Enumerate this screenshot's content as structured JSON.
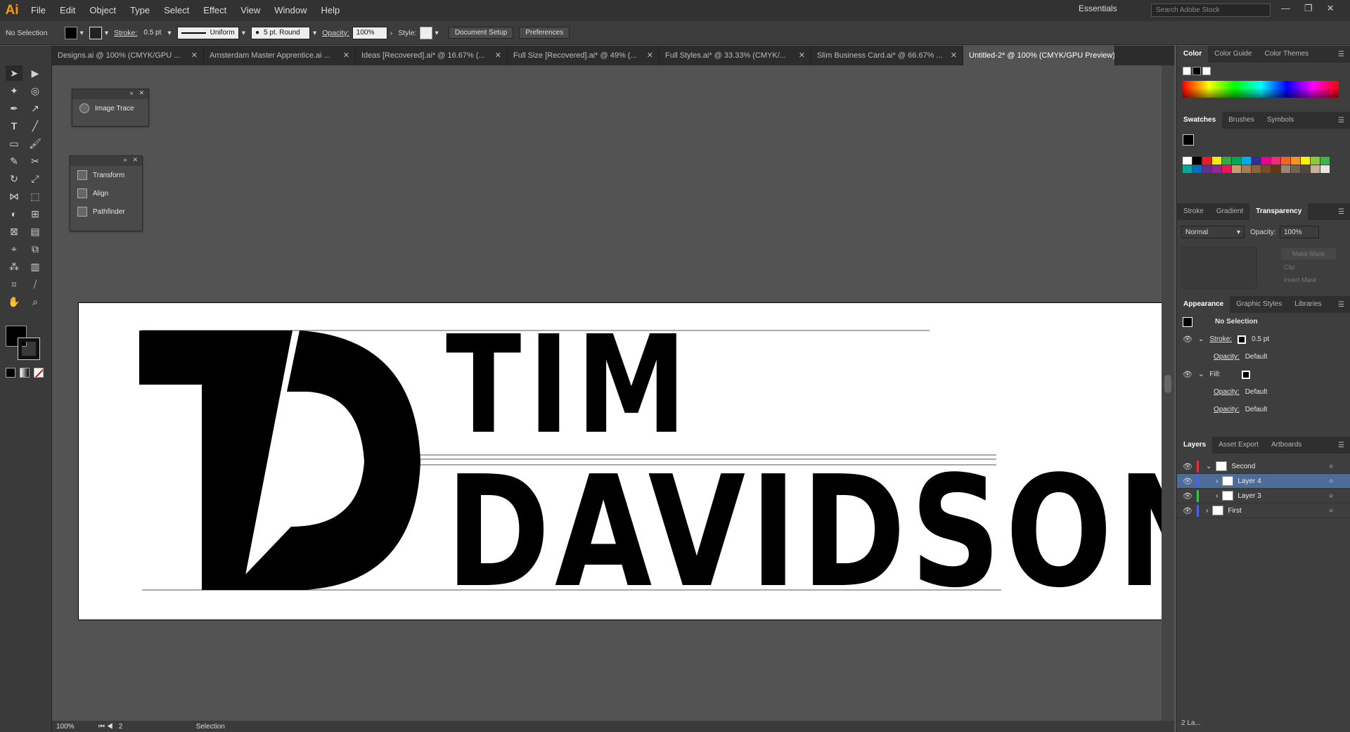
{
  "app": {
    "logo": "Ai"
  },
  "menu": [
    "File",
    "Edit",
    "Object",
    "Type",
    "Select",
    "Effect",
    "View",
    "Window",
    "Help"
  ],
  "workspace": {
    "name": "Essentials",
    "search_placeholder": "Search Adobe Stock"
  },
  "control_bar": {
    "selection": "No Selection",
    "stroke_label": "Stroke:",
    "stroke_value": "0.5 pt",
    "profile": "Uniform",
    "brush": "5 pt. Round",
    "opacity_label": "Opacity:",
    "opacity_value": "100%",
    "style_label": "Style:",
    "doc_setup": "Document Setup",
    "preferences": "Preferences"
  },
  "tabs": [
    "Designs.ai @ 100% (CMYK/GPU ...",
    "Amsterdam Master Apprentice.ai ...",
    "Ideas [Recovered].ai* @ 16.67% (...",
    "Full Size [Recovered].ai* @ 49% (...",
    "Full Styles.ai* @ 33.33% (CMYK/...",
    "Slim Business Card.ai* @ 66.67% ...",
    "Untitled-2* @ 100% (CMYK/GPU Preview)"
  ],
  "float_panels": {
    "image_trace": "Image Trace",
    "transform": "Transform",
    "align": "Align",
    "pathfinder": "Pathfinder"
  },
  "artwork": {
    "line1": "TIM",
    "line2": "DAVIDSON"
  },
  "color_panel": {
    "tabs": [
      "Color",
      "Color Guide",
      "Color Themes"
    ]
  },
  "swatches_panel": {
    "tabs": [
      "Swatches",
      "Brushes",
      "Symbols"
    ]
  },
  "transparency_panel": {
    "tabs": [
      "Stroke",
      "Gradient",
      "Transparency"
    ],
    "mode": "Normal",
    "opacity_label": "Opacity:",
    "opacity": "100%",
    "make_mask": "Make Mask",
    "clip": "Clip",
    "invert": "Invert Mask"
  },
  "appearance": {
    "tabs": [
      "Appearance",
      "Graphic Styles",
      "Libraries"
    ],
    "title": "No Selection",
    "stroke": "Stroke:",
    "stroke_val": "0.5 pt",
    "opacity": "Opacity:",
    "default": "Default",
    "fill": "Fill:"
  },
  "layers": {
    "tabs": [
      "Layers",
      "Asset Export",
      "Artboards"
    ],
    "rows": [
      {
        "name": "Second",
        "color": "#e0313a"
      },
      {
        "name": "Layer 4",
        "color": "#4c62e0"
      },
      {
        "name": "Layer 3",
        "color": "#3cc24a"
      },
      {
        "name": "First",
        "color": "#4c62e0"
      }
    ],
    "count": "2 La..."
  },
  "status": {
    "zoom": "100%",
    "artboard": "2",
    "tool": "Selection"
  },
  "swatch_colors": [
    "#ffffff",
    "#000000",
    "#ed1c24",
    "#f7ec13",
    "#35a846",
    "#00a651",
    "#00aeef",
    "#2e3192",
    "#ec008c",
    "#ee2d7b",
    "#f26522",
    "#f7941d",
    "#fff200",
    "#8dc63f",
    "#39b54a",
    "#00a99d",
    "#0072bc",
    "#662d91",
    "#92278f",
    "#ed145b",
    "#c69c6d",
    "#a67c52",
    "#8c6239",
    "#754c24",
    "#603913",
    "#998675",
    "#736357",
    "#534741",
    "#c7b299",
    "#e6e6e6"
  ]
}
